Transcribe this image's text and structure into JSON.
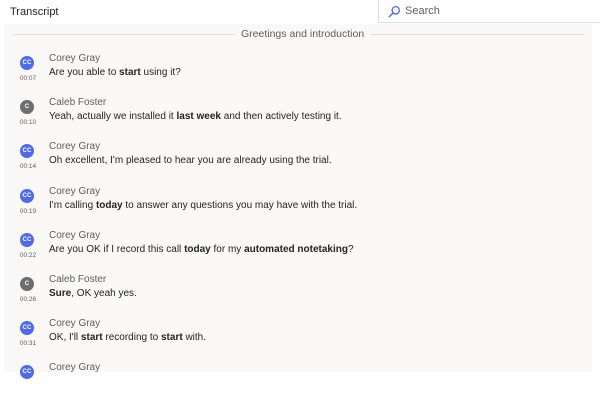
{
  "header": {
    "title": "Transcript",
    "search_placeholder": "Search"
  },
  "section": {
    "title": "Greetings and introduction"
  },
  "colors": {
    "corey": "#4f6bed",
    "caleb": "#6e6e6e"
  },
  "entries": [
    {
      "initials": "CC",
      "speaker": "Corey Gray",
      "time": "00:07",
      "color": "#4f6bed",
      "segments": [
        {
          "t": "Are you able to "
        },
        {
          "t": "start",
          "b": true
        },
        {
          "t": " using it?"
        }
      ]
    },
    {
      "initials": "C",
      "speaker": "Caleb Foster",
      "time": "00:10",
      "color": "#6e6e6e",
      "segments": [
        {
          "t": "Yeah, actually we installed it "
        },
        {
          "t": "last week",
          "b": true
        },
        {
          "t": " and then actively testing it."
        }
      ]
    },
    {
      "initials": "CC",
      "speaker": "Corey Gray",
      "time": "00:14",
      "color": "#4f6bed",
      "segments": [
        {
          "t": "Oh excellent, I'm pleased to hear you are already using the trial."
        }
      ]
    },
    {
      "initials": "CC",
      "speaker": "Corey Gray",
      "time": "00:19",
      "color": "#4f6bed",
      "segments": [
        {
          "t": "I'm calling "
        },
        {
          "t": "today",
          "b": true
        },
        {
          "t": " to answer any questions you may have with the trial."
        }
      ]
    },
    {
      "initials": "CC",
      "speaker": "Corey Gray",
      "time": "00:22",
      "color": "#4f6bed",
      "segments": [
        {
          "t": "Are you OK if I record this call "
        },
        {
          "t": "today",
          "b": true
        },
        {
          "t": " for my "
        },
        {
          "t": "automated notetaking",
          "b": true
        },
        {
          "t": "?"
        }
      ]
    },
    {
      "initials": "C",
      "speaker": "Caleb Foster",
      "time": "00:26",
      "color": "#6e6e6e",
      "segments": [
        {
          "t": "Sure",
          "b": true
        },
        {
          "t": ", OK yeah yes."
        }
      ]
    },
    {
      "initials": "CC",
      "speaker": "Corey Gray",
      "time": "00:31",
      "color": "#4f6bed",
      "segments": [
        {
          "t": "OK, I'll "
        },
        {
          "t": "start",
          "b": true
        },
        {
          "t": " recording to "
        },
        {
          "t": "start",
          "b": true
        },
        {
          "t": " with."
        }
      ]
    },
    {
      "initials": "CC",
      "speaker": "Corey Gray",
      "time": "",
      "color": "#4f6bed",
      "segments": []
    }
  ]
}
